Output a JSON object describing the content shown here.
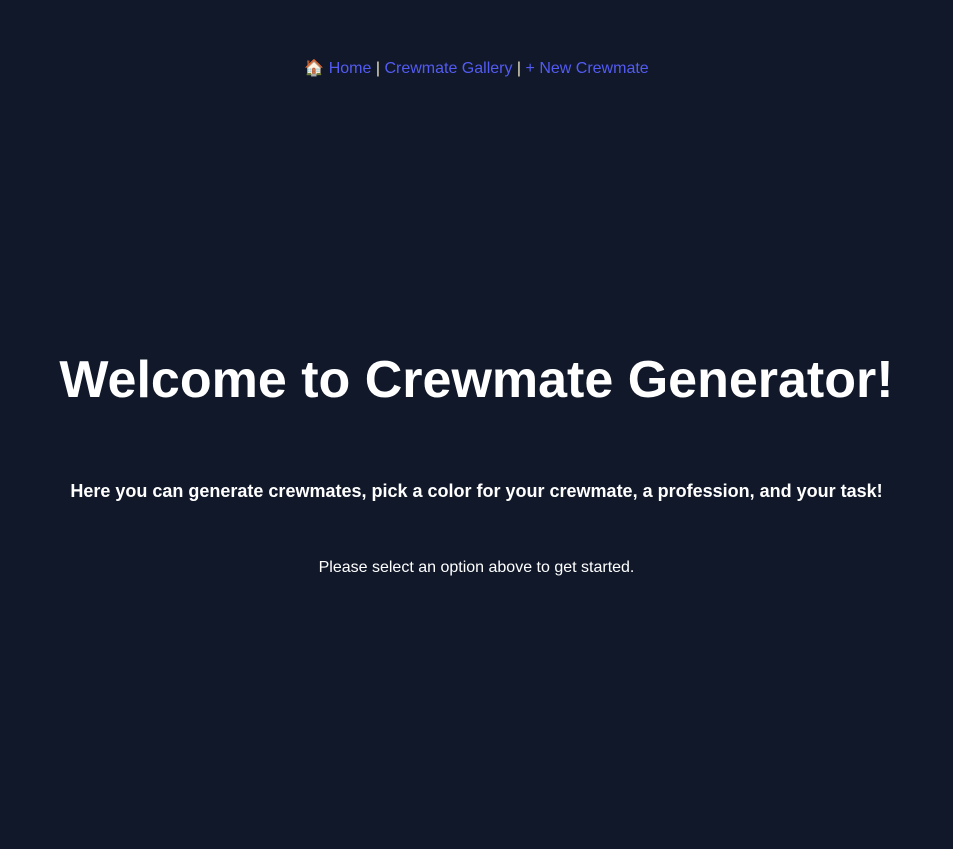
{
  "nav": {
    "home_icon": "house-emoji",
    "home_label": "Home",
    "separator": "|",
    "gallery_label": "Crewmate Gallery",
    "new_label": "+ New Crewmate"
  },
  "main": {
    "title": "Welcome to Crewmate Generator!",
    "subtitle": "Here you can generate crewmates, pick a color for your crewmate, a profession, and your task!",
    "hint": "Please select an option above to get started."
  },
  "colors": {
    "background": "#10182a",
    "link": "#535bf2"
  }
}
